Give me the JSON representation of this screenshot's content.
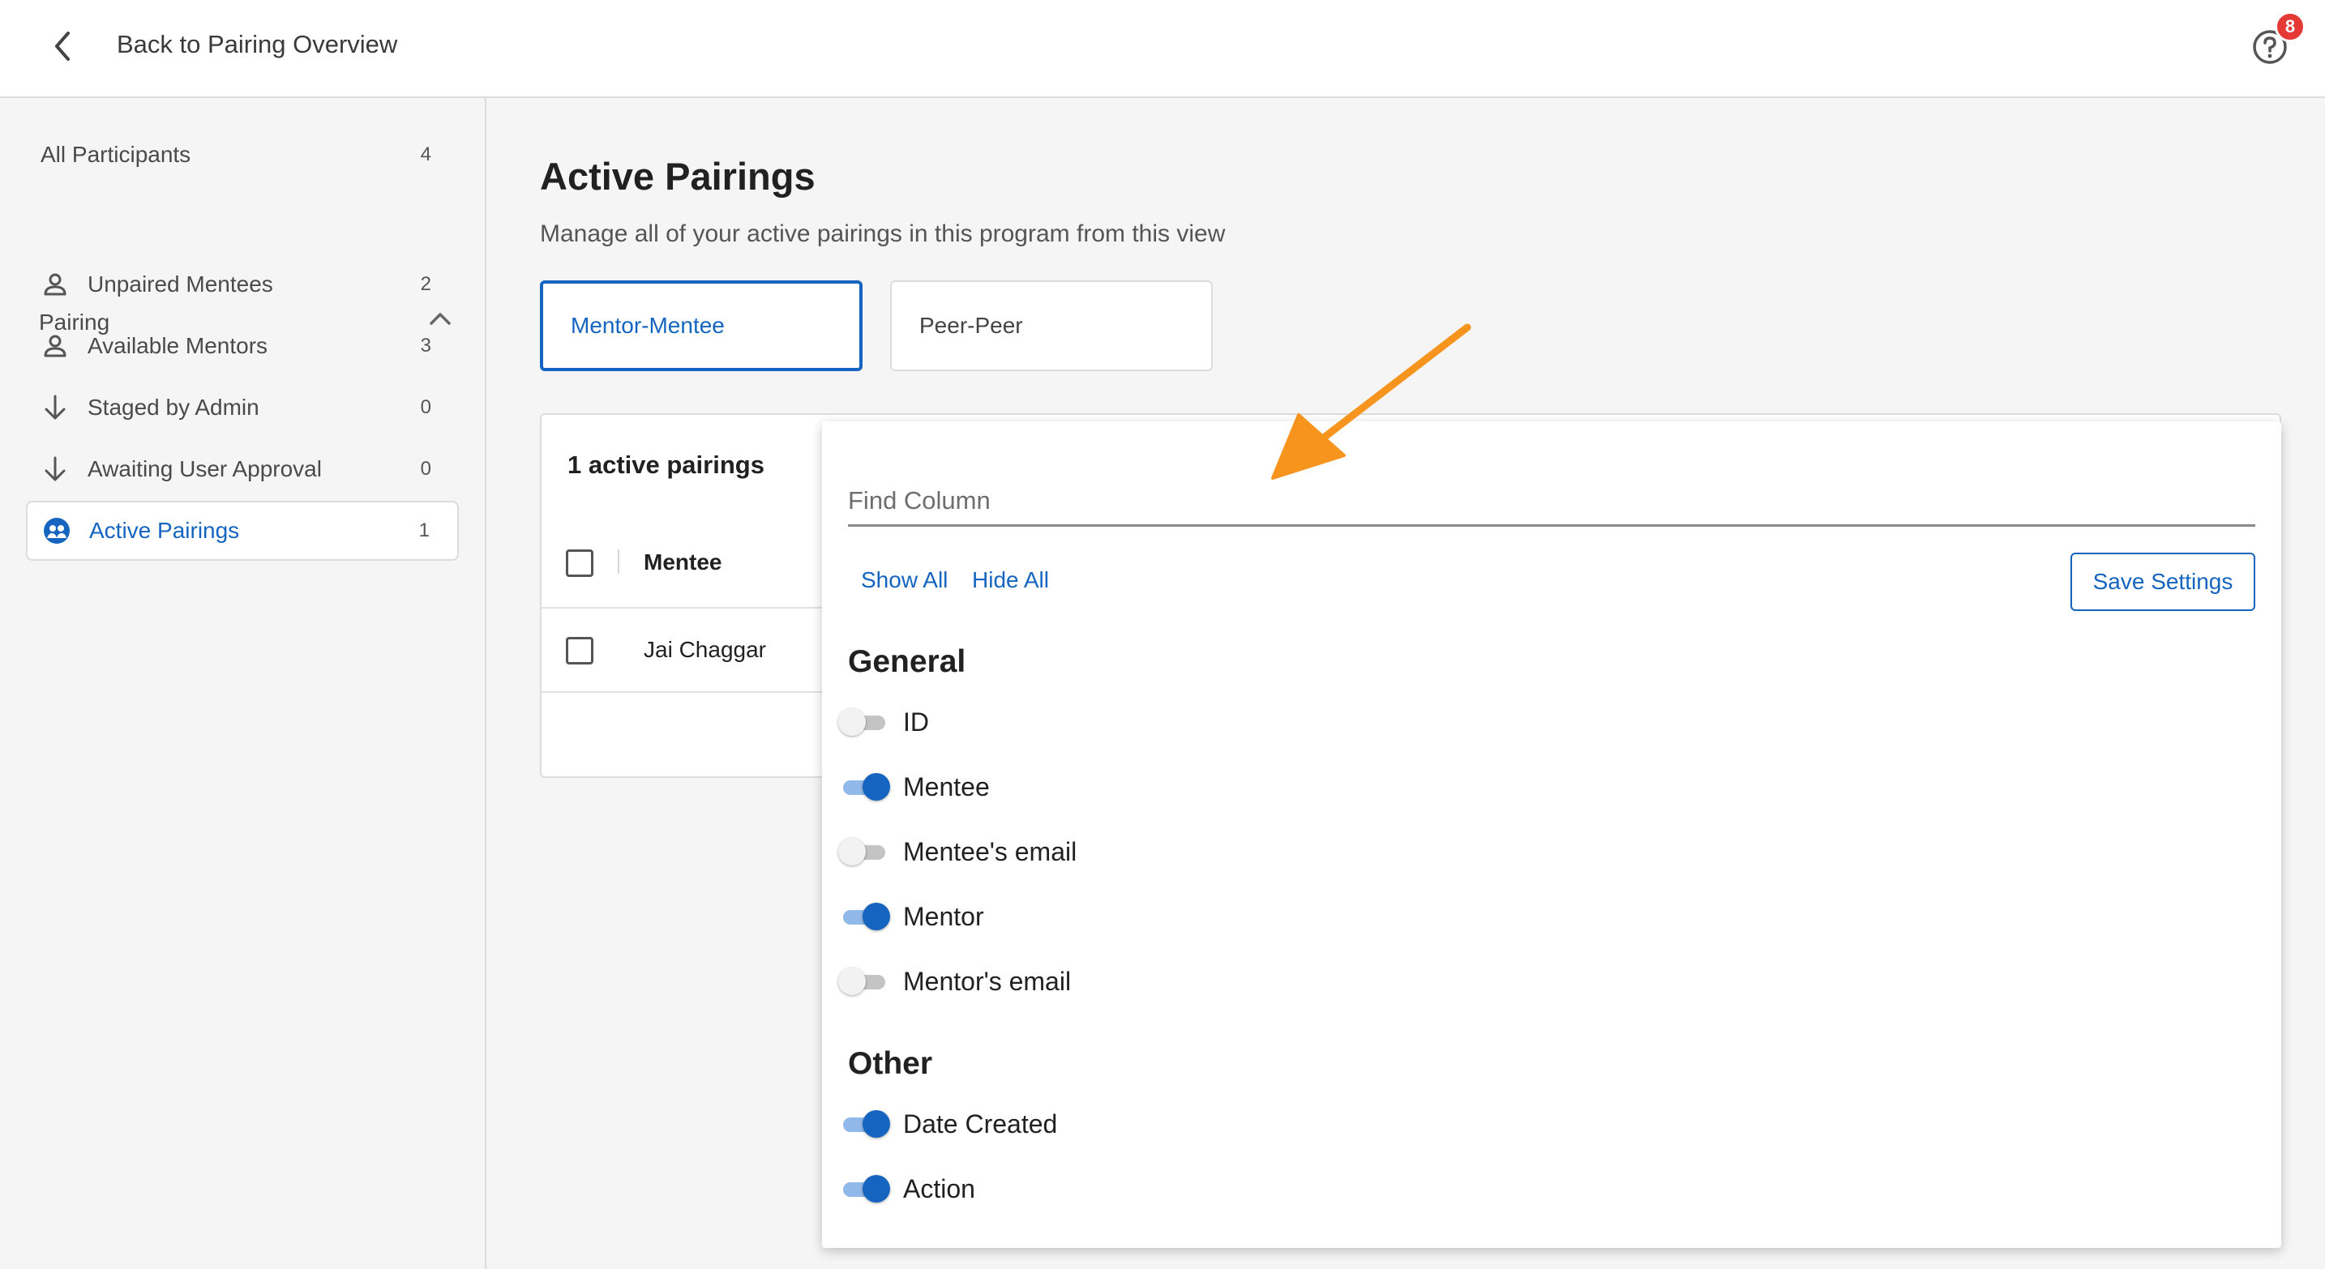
{
  "header": {
    "back_label": "Back to Pairing Overview",
    "help_badge": "8"
  },
  "sidebar": {
    "all_participants": {
      "label": "All Participants",
      "count": "4"
    },
    "section": "Pairing",
    "items": [
      {
        "label": "Unpaired Mentees",
        "count": "2",
        "icon": "person-icon"
      },
      {
        "label": "Available Mentors",
        "count": "3",
        "icon": "person-icon"
      },
      {
        "label": "Staged by Admin",
        "count": "0",
        "icon": "arrow-down-icon"
      },
      {
        "label": "Awaiting User Approval",
        "count": "0",
        "icon": "arrow-down-icon"
      },
      {
        "label": "Active Pairings",
        "count": "1",
        "icon": "pairing-icon"
      }
    ]
  },
  "main": {
    "title": "Active Pairings",
    "subtitle": "Manage all of your active pairings in this program from this view",
    "tabs": [
      {
        "label": "Mentor-Mentee",
        "active": true
      },
      {
        "label": "Peer-Peer",
        "active": false
      }
    ],
    "table": {
      "count_label": "1 active pairings",
      "columns": [
        "Mentee"
      ],
      "rows": [
        [
          "Jai Chaggar"
        ]
      ]
    }
  },
  "column_settings": {
    "search_placeholder": "Find Column",
    "show_all": "Show All",
    "hide_all": "Hide All",
    "save": "Save Settings",
    "groups": [
      {
        "title": "General",
        "columns": [
          {
            "label": "ID",
            "on": false
          },
          {
            "label": "Mentee",
            "on": true
          },
          {
            "label": "Mentee's email",
            "on": false
          },
          {
            "label": "Mentor",
            "on": true
          },
          {
            "label": "Mentor's email",
            "on": false
          }
        ]
      },
      {
        "title": "Other",
        "columns": [
          {
            "label": "Date Created",
            "on": true
          },
          {
            "label": "Action",
            "on": true
          }
        ]
      }
    ]
  },
  "colors": {
    "accent": "#1565c0",
    "annotation_arrow": "#f7941d",
    "badge": "#e53935"
  }
}
